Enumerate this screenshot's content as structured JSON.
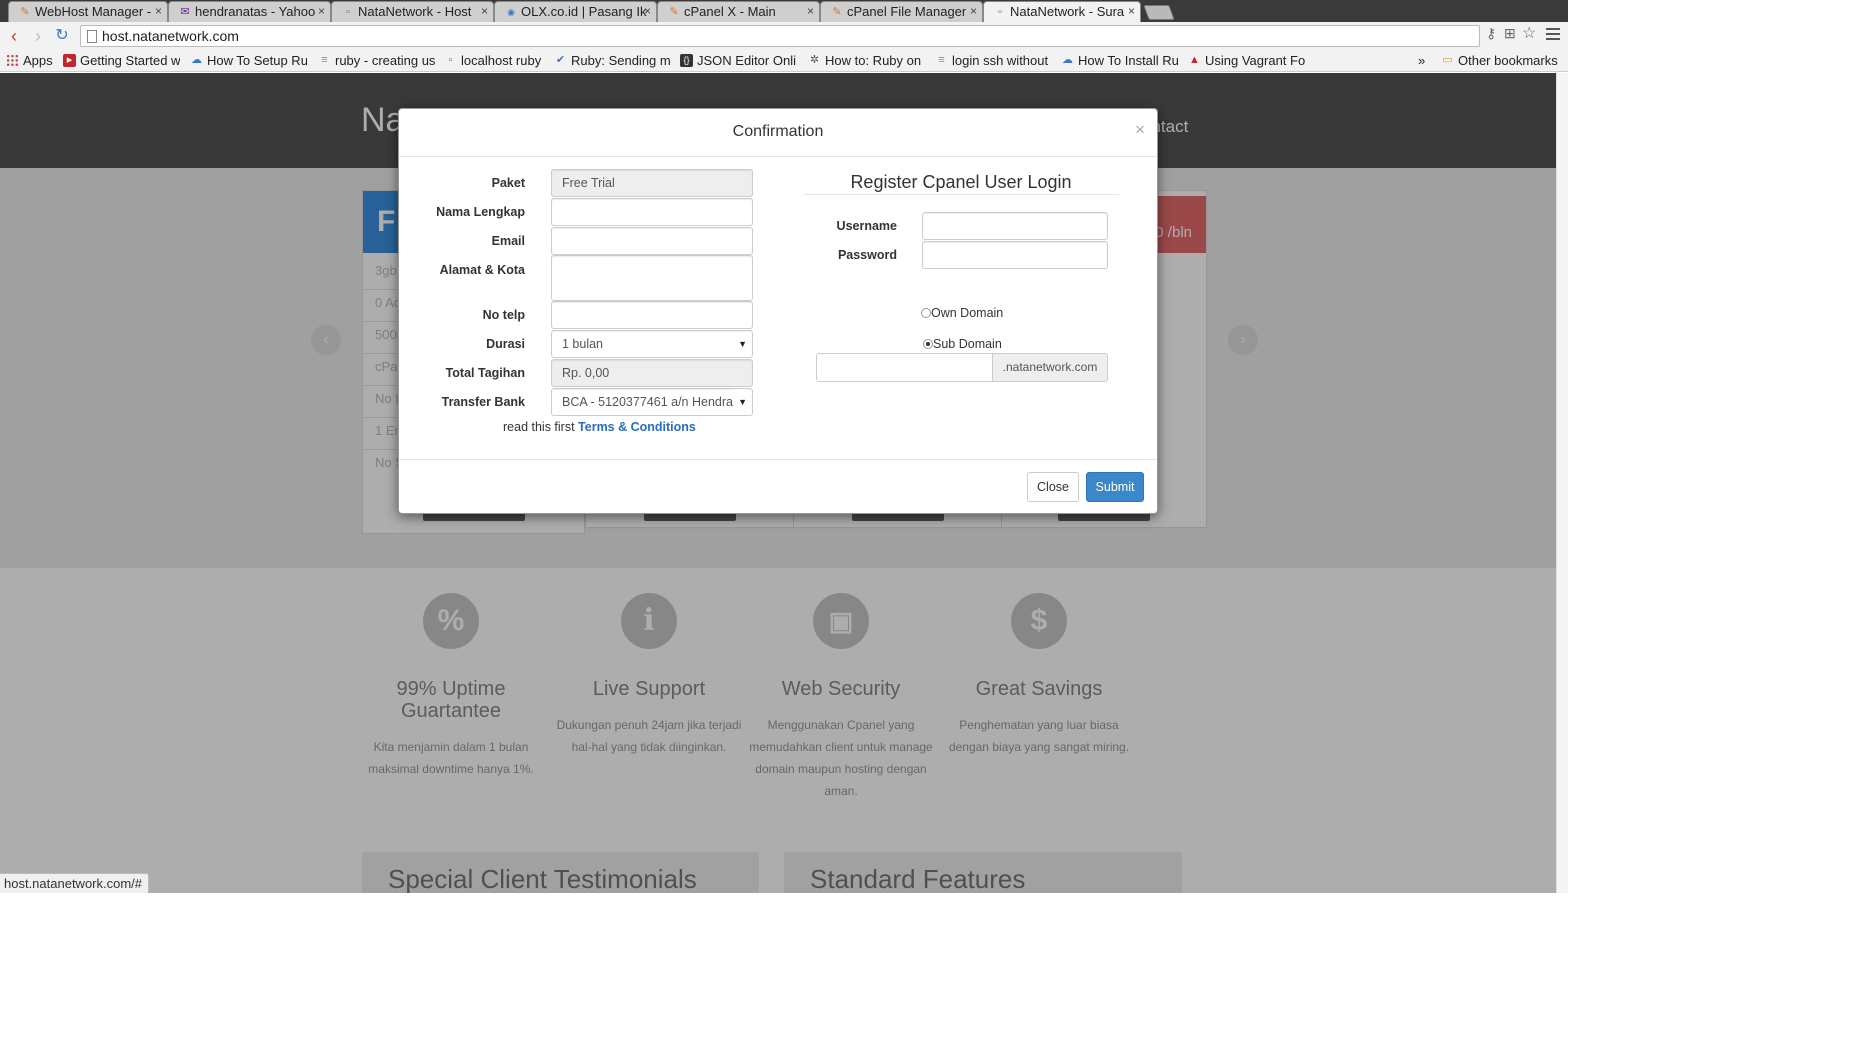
{
  "browser": {
    "tabs": [
      {
        "label": "WebHost Manager -",
        "favicon": "cpanel-icon",
        "active": false
      },
      {
        "label": "hendranatas - Yahoo",
        "favicon": "mail-icon",
        "active": false
      },
      {
        "label": "NataNetwork - Host",
        "favicon": "page-icon",
        "active": false
      },
      {
        "label": "OLX.co.id | Pasang Ik",
        "favicon": "olx-icon",
        "active": false
      },
      {
        "label": "cPanel X - Main",
        "favicon": "cpanel-icon",
        "active": false
      },
      {
        "label": "cPanel File Manager",
        "favicon": "cpanel-icon",
        "active": false
      },
      {
        "label": "NataNetwork - Sura",
        "favicon": "page-icon",
        "active": true
      }
    ],
    "url": "host.natanetwork.com",
    "bookmarks": [
      {
        "label": "Apps"
      },
      {
        "label": "Getting Started w"
      },
      {
        "label": "How To Setup Ru"
      },
      {
        "label": "ruby - creating us"
      },
      {
        "label": "localhost ruby"
      },
      {
        "label": "Ruby: Sending ma"
      },
      {
        "label": "JSON Editor Onli"
      },
      {
        "label": "How to: Ruby on"
      },
      {
        "label": "login ssh without"
      },
      {
        "label": "How To Install Ru"
      },
      {
        "label": "Using Vagrant Fo"
      }
    ],
    "bookmarks_overflow": "»",
    "other_bookmarks": "Other bookmarks",
    "status_url": "host.natanetwork.com/#"
  },
  "site": {
    "logo_partial": "Nat",
    "nav_partial": "ontact",
    "card1_letter": "F",
    "card1_rows": [
      "3gb",
      "0 Ad",
      "500r",
      "cPar",
      "No L",
      "1 Em",
      "No S"
    ],
    "card4_price": "0 /bln",
    "features": [
      {
        "icon": "percent-icon",
        "glyph": "%",
        "title": "99% Uptime Guartantee",
        "text": "Kita menjamin dalam 1 bulan maksimal downtime hanya 1%."
      },
      {
        "icon": "info-icon",
        "glyph": "i",
        "title": "Live Support",
        "text": "Dukungan penuh 24jam jika terjadi hal-hal yang tidak diinginkan."
      },
      {
        "icon": "lock-icon",
        "glyph": "🔒",
        "title": "Web Security",
        "text": "Menggunakan Cpanel yang memudahkan client untuk manage domain maupun hosting dengan aman."
      },
      {
        "icon": "dollar-icon",
        "glyph": "$",
        "title": "Great Savings",
        "text": "Penghematan yang luar biasa dengan biaya yang sangat miring."
      }
    ],
    "bottom_boxes": [
      "Special Client Testimonials",
      "Standard Features"
    ]
  },
  "modal": {
    "title": "Confirmation",
    "close_x": "×",
    "form": {
      "paket_label": "Paket",
      "paket_value": "Free Trial",
      "nama_label": "Nama Lengkap",
      "nama_value": "",
      "email_label": "Email",
      "email_value": "",
      "alamat_label": "Alamat & Kota",
      "alamat_value": "",
      "telp_label": "No telp",
      "telp_value": "",
      "durasi_label": "Durasi",
      "durasi_value": "1 bulan",
      "total_label": "Total Tagihan",
      "total_value": "Rp. 0,00",
      "bank_label": "Transfer Bank",
      "bank_value": "BCA - 5120377461 a/n Hendra",
      "terms_prefix": "read this first",
      "terms_link": "Terms & Conditions"
    },
    "register": {
      "title": "Register Cpanel User Login",
      "username_label": "Username",
      "username_value": "",
      "password_label": "Password",
      "password_value": "",
      "own_domain_label": "Own Domain",
      "sub_domain_label": "Sub Domain",
      "selected_domain_type": "Sub Domain",
      "subdomain_value": "",
      "subdomain_suffix": ".natanetwork.com"
    },
    "close_button": "Close",
    "submit_button": "Submit"
  }
}
